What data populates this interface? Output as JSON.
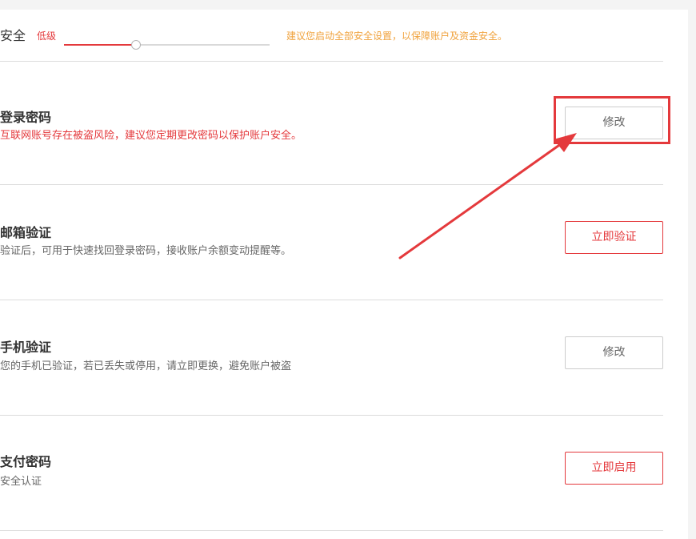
{
  "header": {
    "title": "安全",
    "level_label": "低级",
    "level_fraction": 0.35,
    "tip": "建议您启动全部安全设置，以保障账户及资金安全。"
  },
  "items": [
    {
      "title": "登录密码",
      "desc": "互联网账号存在被盗风险，建议您定期更改密码以保护账户安全。",
      "button": "修改"
    },
    {
      "title": "邮箱验证",
      "desc": "验证后，可用于快速找回登录密码，接收账户余额变动提醒等。",
      "button": "立即验证"
    },
    {
      "title": "手机验证",
      "desc": "您的手机已验证，若已丢失或停用，请立即更换，避免账户被盗",
      "button": "修改"
    },
    {
      "title": "支付密码",
      "desc": "安全认证",
      "button": "立即启用"
    }
  ],
  "colors": {
    "accent": "#e4393c",
    "tip": "#f0a23c"
  }
}
